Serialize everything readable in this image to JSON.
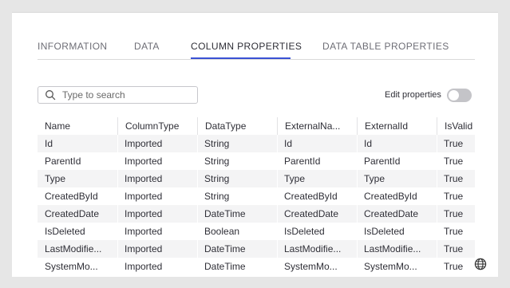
{
  "tabs": [
    {
      "label": "INFORMATION"
    },
    {
      "label": "DATA"
    },
    {
      "label": "COLUMN PROPERTIES"
    },
    {
      "label": "DATA TABLE PROPERTIES"
    }
  ],
  "active_tab": "COLUMN PROPERTIES",
  "search": {
    "placeholder": "Type to search",
    "value": ""
  },
  "edit_properties": {
    "label": "Edit properties",
    "enabled": false
  },
  "table": {
    "columns": [
      "Name",
      "ColumnType",
      "DataType",
      "ExternalNa...",
      "ExternalId",
      "IsValid"
    ],
    "rows": [
      [
        "Id",
        "Imported",
        "String",
        "Id",
        "Id",
        "True"
      ],
      [
        "ParentId",
        "Imported",
        "String",
        "ParentId",
        "ParentId",
        "True"
      ],
      [
        "Type",
        "Imported",
        "String",
        "Type",
        "Type",
        "True"
      ],
      [
        "CreatedById",
        "Imported",
        "String",
        "CreatedById",
        "CreatedById",
        "True"
      ],
      [
        "CreatedDate",
        "Imported",
        "DateTime",
        "CreatedDate",
        "CreatedDate",
        "True"
      ],
      [
        "IsDeleted",
        "Imported",
        "Boolean",
        "IsDeleted",
        "IsDeleted",
        "True"
      ],
      [
        "LastModifie...",
        "Imported",
        "DateTime",
        "LastModifie...",
        "LastModifie...",
        "True"
      ],
      [
        "SystemMo...",
        "Imported",
        "DateTime",
        "SystemMo...",
        "SystemMo...",
        "True"
      ]
    ]
  },
  "icons": {
    "search": "search-icon",
    "globe": "globe-icon"
  },
  "colors": {
    "accent": "#3a52d4",
    "stripe": "#f4f4f5",
    "toggle_off": "#c4c4c8"
  }
}
